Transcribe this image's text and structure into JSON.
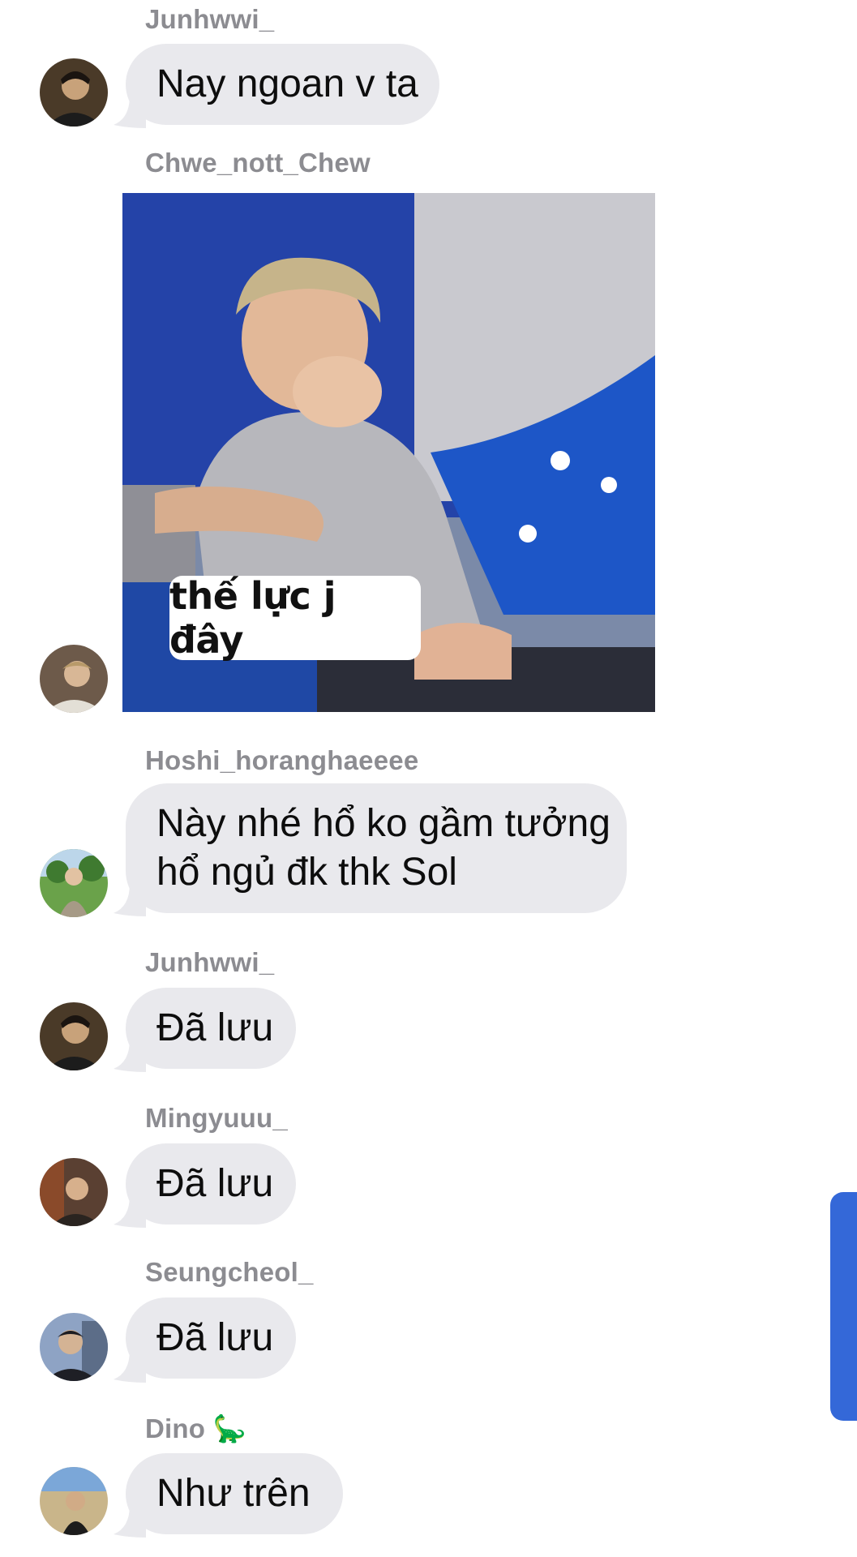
{
  "messages": [
    {
      "sender": "Junhwwi_",
      "text": "Nay ngoan v ta"
    },
    {
      "sender": "Chwe_nott_Chew",
      "image_caption": "thế lực j đây"
    },
    {
      "sender": "Hoshi_horanghaeeee",
      "line1": "Này nhé hổ ko gầm tưởng",
      "line2": "hổ ngủ đk thk Sol"
    },
    {
      "sender": "Junhwwi_",
      "text": "Đã lưu"
    },
    {
      "sender": "Mingyuuu_",
      "text": "Đã lưu"
    },
    {
      "sender": "Seungcheol_",
      "text": "Đã lưu"
    },
    {
      "sender": "Dino",
      "sender_emoji": "🦕",
      "text": "Như trên"
    }
  ],
  "colors": {
    "bubble": "#e9e9ed",
    "sender": "#8c8c91",
    "scrollbar": "#3468d8"
  },
  "icons": {
    "avatar": "user-avatar-photo",
    "scroll": "scroll-indicator"
  }
}
